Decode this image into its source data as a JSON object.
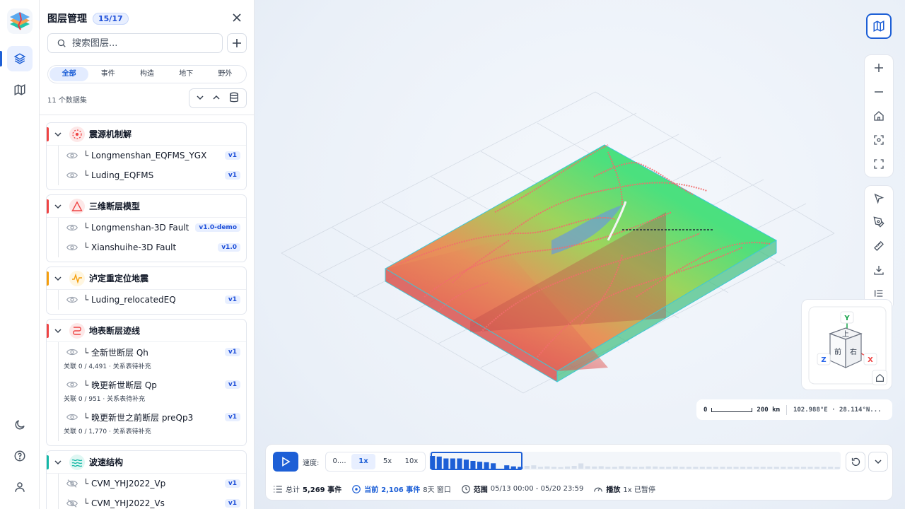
{
  "panel": {
    "title": "图层管理",
    "count_badge": "15/17",
    "search_placeholder": "搜索图层...",
    "tabs": [
      "全部",
      "事件",
      "构造",
      "地下",
      "野外"
    ],
    "dataset_count": "11 个数据集"
  },
  "groups": [
    {
      "name": "震源机制解",
      "color": "#ef4444",
      "layers": [
        {
          "label": "└ Longmenshan_EQFMS_YGX",
          "version": "v1"
        },
        {
          "label": "└ Luding_EQFMS",
          "version": "v1"
        }
      ]
    },
    {
      "name": "三维断层模型",
      "color": "#ef4444",
      "layers": [
        {
          "label": "└ Longmenshan-3D Fault",
          "version": "v1.0-demo"
        },
        {
          "label": "└ Xianshuihe-3D Fault",
          "version": "v1.0"
        }
      ]
    },
    {
      "name": "泸定重定位地震",
      "color": "#f59e0b",
      "layers": [
        {
          "label": "└ Luding_relocatedEQ",
          "version": "v1"
        }
      ]
    },
    {
      "name": "地表断层迹线",
      "color": "#ef4444",
      "layers": [
        {
          "label": "└ 全新世断层 Qh",
          "version": "v1",
          "note": "关联 0 / 4,491 · 关系表待补充"
        },
        {
          "label": "└ 晚更新世断层 Qp",
          "version": "v1",
          "note": "关联 0 / 951 · 关系表待补充"
        },
        {
          "label": "└ 晚更新世之前断层 preQp3",
          "version": "v1",
          "note": "关联 0 / 1,770 · 关系表待补充"
        }
      ]
    },
    {
      "name": "波速结构",
      "color": "#14b8a6",
      "layers": [
        {
          "label": "└ CVM_YHJ2022_Vp",
          "version": "v1"
        },
        {
          "label": "└ CVM_YHJ2022_Vs",
          "version": "v1"
        }
      ]
    }
  ],
  "viewcube": {
    "y": "Y",
    "z": "Z",
    "x": "X",
    "top": "上",
    "front": "前",
    "right": "右"
  },
  "scale": {
    "zero": "0",
    "distance": "200 km",
    "coords": "102.988°E · 28.114°N..."
  },
  "timeline": {
    "speed_label": "速度:",
    "speeds": [
      "0....",
      "1x",
      "5x",
      "10x"
    ],
    "histogram": [
      0.82,
      0.78,
      0.66,
      0.66,
      0.66,
      0.58,
      0.5,
      0.45,
      0.42,
      0.35,
      0.0,
      0.22,
      0.15,
      0.12,
      0.18,
      0.22,
      0.12,
      0.15,
      0.12,
      0.1,
      0.14,
      0.18,
      0.34,
      0.16,
      0.14,
      0.16,
      0.12,
      0.12,
      0.16,
      0.14,
      0.12,
      0.12,
      0.15,
      0.14,
      0.12,
      0.12,
      0.14,
      0.12,
      0.12,
      0.12,
      0.12,
      0.12,
      0.12,
      0.12,
      0.12,
      0.12,
      0.12,
      0.12,
      0.12,
      0.12,
      0.12,
      0.12,
      0.12,
      0.12,
      0.12,
      0.12,
      0.12,
      0.12,
      0.12,
      0.12,
      0.1
    ],
    "total_label": "总计",
    "total_value": "5,269 事件",
    "current_label": "当前",
    "current_value": "2,106 事件",
    "window": "8天 窗口",
    "range_label": "范围",
    "range_value": "05/13 00:00 - 05/20 23:59",
    "play_label": "播放",
    "play_value": "1x 已暂停"
  },
  "colors": {
    "accent": "#1d5fd6",
    "fault": "#f26d6d",
    "box": "#3cc8d8"
  }
}
